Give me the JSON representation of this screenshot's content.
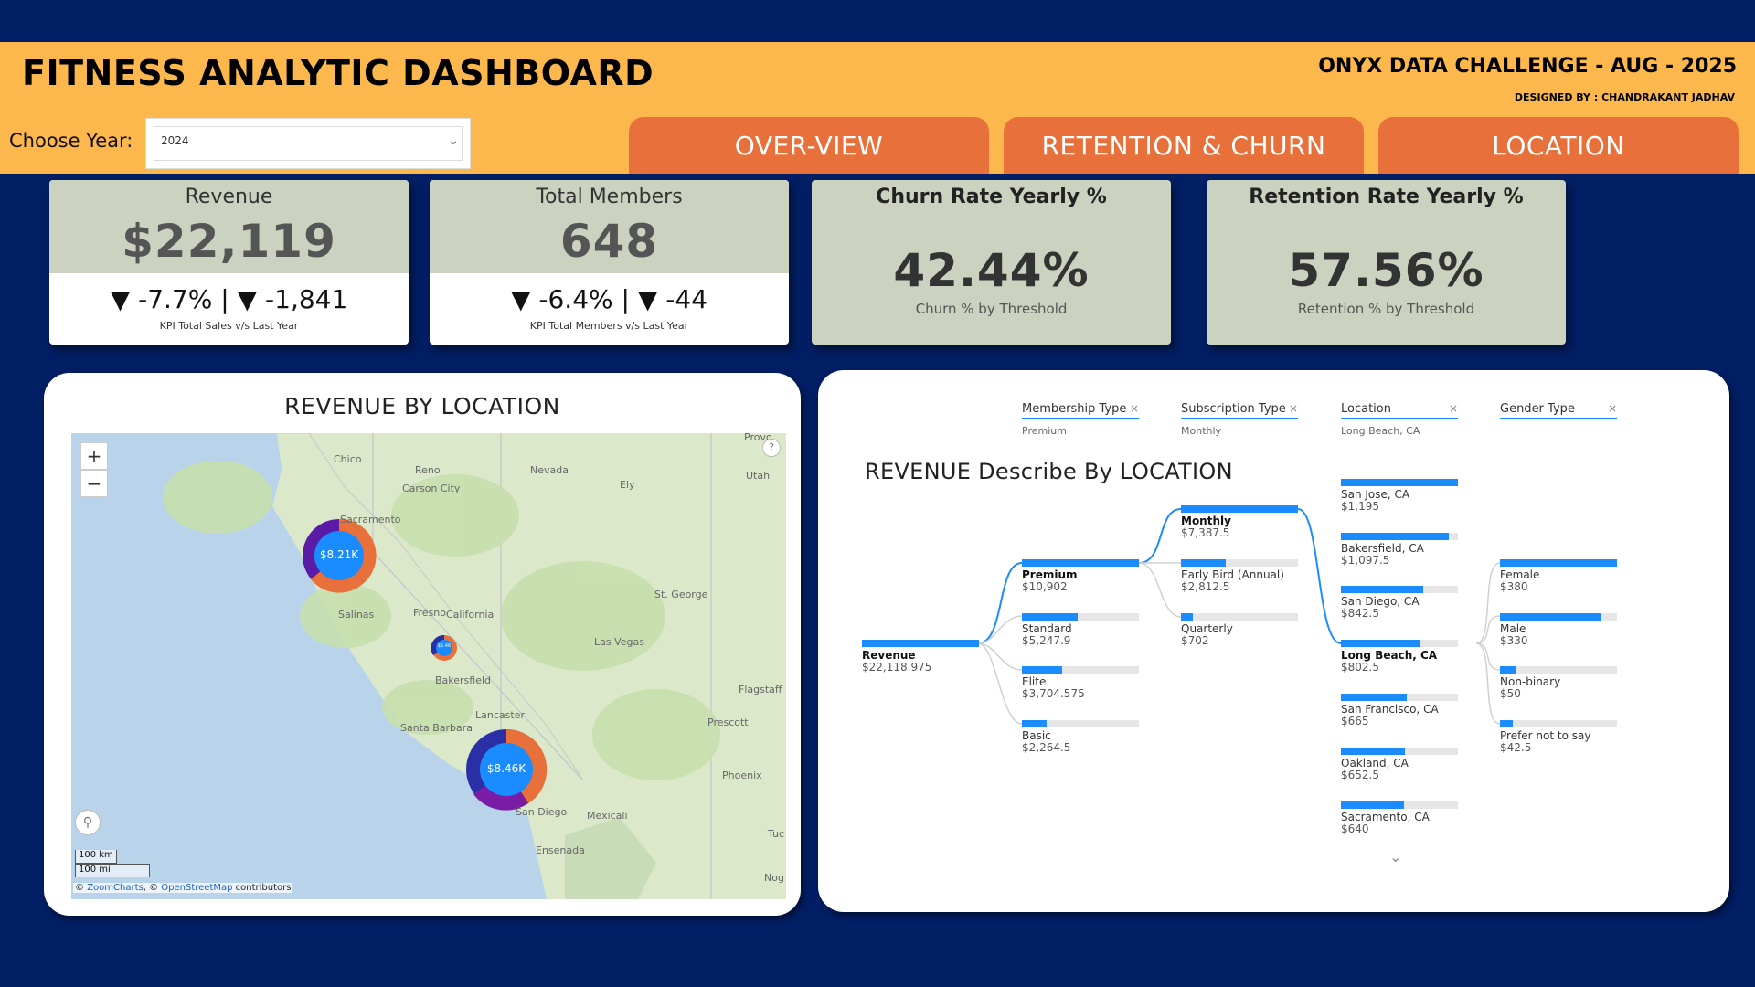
{
  "header": {
    "title": "FITNESS ANALYTIC DASHBOARD",
    "challenge": "ONYX DATA CHALLENGE - AUG - 2025",
    "designer": "DESIGNED BY : CHANDRAKANT JADHAV",
    "year_label": "Choose Year:",
    "year_value": "2024",
    "nav": [
      "OVER-VIEW",
      "RETENTION & CHURN",
      "LOCATION"
    ]
  },
  "colors": {
    "background": "#021f66",
    "header": "#fdb84d",
    "nav": "#e8703a",
    "card": "#cbd2bf",
    "accent": "#1a8cff"
  },
  "kpis": [
    {
      "label": "Revenue",
      "value": "$22,119",
      "change": "▼ -7.7% | ▼ -1,841",
      "sub": "KPI Total Sales v/s Last Year"
    },
    {
      "label": "Total Members",
      "value": "648",
      "change": "▼ -6.4% | ▼ -44",
      "sub": "KPI Total Members v/s Last Year"
    },
    {
      "label": "Churn Rate Yearly %",
      "value": "42.44%",
      "sub": "Churn % by Threshold"
    },
    {
      "label": "Retention Rate Yearly %",
      "value": "57.56%",
      "sub": "Retention % by Threshold"
    }
  ],
  "map": {
    "title": "REVENUE BY LOCATION",
    "zoom_in": "+",
    "zoom_out": "−",
    "bubbles": [
      "$8.21K",
      "$8.46K",
      "$5.46"
    ],
    "labels": [
      "Chico",
      "Reno",
      "Carson City",
      "Nevada",
      "Ely",
      "Utah",
      "Sacramento",
      "Salinas",
      "Fresno",
      "California",
      "Bakersfield",
      "St. George",
      "Las Vegas",
      "Flagstaff",
      "Lancaster",
      "Santa Barbara",
      "Prescott",
      "Phoenix",
      "San Diego",
      "Mexicali",
      "Ensenada",
      "Tuc",
      "Nog",
      "Provo"
    ],
    "scale_km": "100 km",
    "scale_mi": "100 mi",
    "attribution_prefix": "©",
    "attribution_zoomcharts": "ZoomCharts",
    "attribution_mid": ", ©",
    "attribution_osm": "OpenStreetMap",
    "attribution_suffix": "contributors"
  },
  "tree": {
    "title": "REVENUE Describe By LOCATION",
    "filters": [
      {
        "name": "Membership Type",
        "selected": "Premium"
      },
      {
        "name": "Subscription Type",
        "selected": "Monthly"
      },
      {
        "name": "Location",
        "selected": "Long Beach, CA"
      },
      {
        "name": "Gender Type",
        "selected": ""
      }
    ],
    "root": {
      "name": "Revenue",
      "value": "$22,118.975",
      "share": 1.0
    },
    "membership": [
      {
        "name": "Premium",
        "value": "$10,902",
        "share": 1.0
      },
      {
        "name": "Standard",
        "value": "$5,247.9",
        "share": 0.48
      },
      {
        "name": "Elite",
        "value": "$3,704.575",
        "share": 0.34
      },
      {
        "name": "Basic",
        "value": "$2,264.5",
        "share": 0.21
      }
    ],
    "subscription": [
      {
        "name": "Monthly",
        "value": "$7,387.5",
        "share": 1.0
      },
      {
        "name": "Early Bird (Annual)",
        "value": "$2,812.5",
        "share": 0.38
      },
      {
        "name": "Quarterly",
        "value": "$702",
        "share": 0.1
      }
    ],
    "location": [
      {
        "name": "San Jose, CA",
        "value": "$1,195",
        "share": 1.0
      },
      {
        "name": "Bakersfield, CA",
        "value": "$1,097.5",
        "share": 0.92
      },
      {
        "name": "San Diego, CA",
        "value": "$842.5",
        "share": 0.7
      },
      {
        "name": "Long Beach, CA",
        "value": "$802.5",
        "share": 0.67
      },
      {
        "name": "San Francisco, CA",
        "value": "$665",
        "share": 0.56
      },
      {
        "name": "Oakland, CA",
        "value": "$652.5",
        "share": 0.55
      },
      {
        "name": "Sacramento, CA",
        "value": "$640",
        "share": 0.54
      }
    ],
    "gender": [
      {
        "name": "Female",
        "value": "$380",
        "share": 1.0
      },
      {
        "name": "Male",
        "value": "$330",
        "share": 0.87
      },
      {
        "name": "Non-binary",
        "value": "$50",
        "share": 0.13
      },
      {
        "name": "Prefer not to say",
        "value": "$42.5",
        "share": 0.11
      }
    ]
  }
}
